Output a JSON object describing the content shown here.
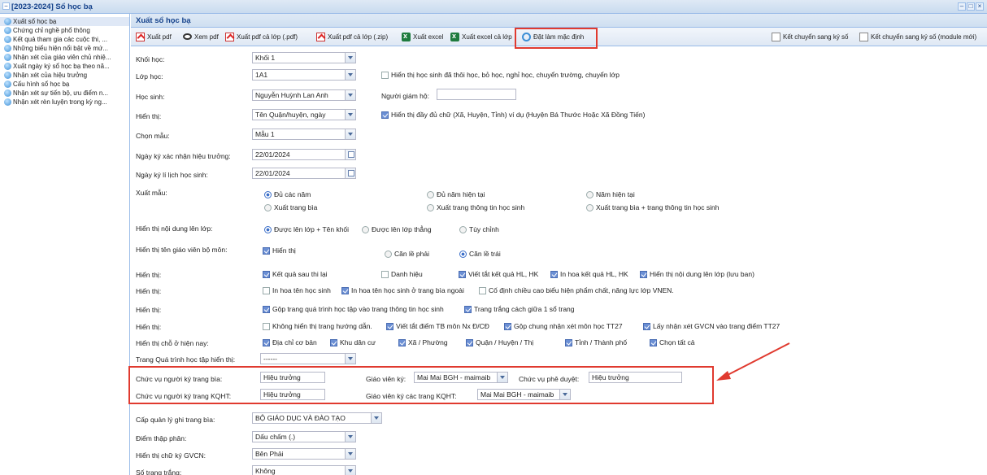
{
  "window": {
    "title": "[2023-2024] Sổ học bạ"
  },
  "sidebar": {
    "items": [
      {
        "label": "Xuất sổ học bạ"
      },
      {
        "label": "Chứng chỉ nghề phổ thông"
      },
      {
        "label": "Kết quả tham gia các cuộc thi, ..."
      },
      {
        "label": "Những biểu hiện nổi bật về mứ..."
      },
      {
        "label": "Nhận xét của giáo viên chủ nhiệ..."
      },
      {
        "label": "Xuất ngày ký sổ học bạ theo nă..."
      },
      {
        "label": "Nhận xét của hiệu trưởng"
      },
      {
        "label": "Cấu hình sổ học bạ"
      },
      {
        "label": "Nhận xét sự tiến bộ, ưu điểm n..."
      },
      {
        "label": "Nhận xét rèn luyện trong kỳ ng..."
      }
    ]
  },
  "panel": {
    "title": "Xuất sổ học bạ"
  },
  "toolbar": {
    "export_pdf": "Xuất pdf",
    "view_pdf": "Xem pdf",
    "export_pdf_class": "Xuất pdf cả lớp (.pdf)",
    "export_pdf_zip": "Xuất pdf cả lớp (.zip)",
    "export_excel": "Xuất excel",
    "export_excel_class": "Xuất excel cả lớp",
    "set_default": "Đặt làm mặc định",
    "transfer": "Kết chuyển sang ký số",
    "transfer_new": "Kết chuyển sang ký số (module mới)"
  },
  "form": {
    "khoi_label": "Khối học:",
    "khoi_value": "Khối 1",
    "lop_label": "Lớp học:",
    "lop_value": "1A1",
    "show_left_students": "Hiển thị học sinh đã thôi học, bỏ học, nghỉ học, chuyển trường, chuyển lớp",
    "hs_label": "Học sinh:",
    "hs_value": "Nguyễn Huỳnh Lan Anh",
    "giamho_label": "Người giám hộ:",
    "giamho_value": "",
    "hienthi_label": "Hiển thị:",
    "hienthi_value": "Tên Quận/huyện, ngày",
    "full_address": "Hiển thị đầy đủ chữ (Xã, Huyện, Tỉnh) ví dụ (Huyện Bá Thước Hoặc Xã Đồng Tiến)",
    "mau_label": "Chọn mẫu:",
    "mau_value": "Mẫu 1",
    "ngay_ht_label": "Ngày ký xác nhận hiệu trưởng:",
    "ngay_ht_value": "22/01/2024",
    "ngay_ll_label": "Ngày ký lí lịch học sinh:",
    "ngay_ll_value": "22/01/2024",
    "xuatmau_label": "Xuất mẫu:",
    "xm_opt1": "Đủ các năm",
    "xm_opt2": "Đủ năm hiện tại",
    "xm_opt3": "Năm hiện tại",
    "xm_opt4": "Xuất trang bìa",
    "xm_opt5": "Xuất trang thông tin học sinh",
    "xm_opt6": "Xuất trang bìa + trang thông tin học sinh",
    "lenlop_label": "Hiển thị nội dung lên lớp:",
    "ll_opt1": "Được lên lớp + Tên khối",
    "ll_opt2": "Được lên lớp thẳng",
    "ll_opt3": "Tùy chỉnh",
    "gvbm_label": "Hiển thị tên giáo viên bộ môn:",
    "gvbm_show": "Hiển thị",
    "gvbm_right": "Căn lề phải",
    "gvbm_left": "Căn lề trái",
    "ht1_label": "Hiển thị:",
    "ht1_a": "Kết quả sau thi lại",
    "ht1_b": "Danh hiệu",
    "ht1_c": "Viết tắt kết quả HL, HK",
    "ht1_d": "In hoa kết quả HL, HK",
    "ht1_e": "Hiển thị nội dung lên lớp (lưu ban)",
    "ht2_label": "Hiển thị:",
    "ht2_a": "In hoa tên học sinh",
    "ht2_b": "In hoa tên học sinh ở trang bìa ngoài",
    "ht2_c": "Cố định chiều cao biểu hiện phẩm chất, năng lực lớp VNEN.",
    "ht3_label": "Hiển thị:",
    "ht3_a": "Gộp trang quá trình học tập vào trang thông tin học sinh",
    "ht3_b": "Trang trắng cách giữa 1 sổ trang",
    "ht4_label": "Hiển thị:",
    "ht4_a": "Không hiển thị trang hướng dẫn.",
    "ht4_b": "Viết tắt điểm TB môn Nx Đ/CĐ",
    "ht4_c": "Gộp chung nhận xét môn học TT27",
    "ht4_d": "Lấy nhận xét GVCN vào trang điểm TT27",
    "addr_label": "Hiển thị chỗ ở hiện nay:",
    "addr_a": "Địa chỉ cơ bản",
    "addr_b": "Khu dân cư",
    "addr_c": "Xã / Phường",
    "addr_d": "Quận / Huyện / Thị",
    "addr_e": "Tỉnh / Thành phố",
    "addr_f": "Chọn tất cả",
    "qt_label": "Trang Quá trình học tập hiển thị:",
    "qt_value": "------",
    "cv_bia_label": "Chức vụ người ký trang bìa:",
    "cv_bia_value": "Hiệu trưởng",
    "gvky_label": "Giáo viên ký:",
    "gvky_value": "Mai Mai BGH - maimaib",
    "cv_pd_label": "Chức vụ phê duyệt:",
    "cv_pd_value": "Hiệu trưởng",
    "cv_kq_label": "Chức vụ người ký trang KQHT:",
    "cv_kq_value": "Hiệu trưởng",
    "gvky_kq_label": "Giáo viên ký các trang KQHT:",
    "gvky_kq_value": "Mai Mai BGH - maimaib",
    "capql_label": "Cấp quản lý ghi trang bìa:",
    "capql_value": "BỘ GIÁO DỤC VÀ ĐÀO TẠO",
    "dtp_label": "Điểm thập phân:",
    "dtp_value": "Dấu chấm (.)",
    "cky_label": "Hiển thị chữ ký GVCN:",
    "cky_value": "Bên Phải",
    "strang_label": "Số trang trắng:",
    "strang_value": "Không"
  },
  "colors": {
    "highlight": "#e03a2f",
    "header": "#15428b",
    "border": "#99bbe8"
  }
}
